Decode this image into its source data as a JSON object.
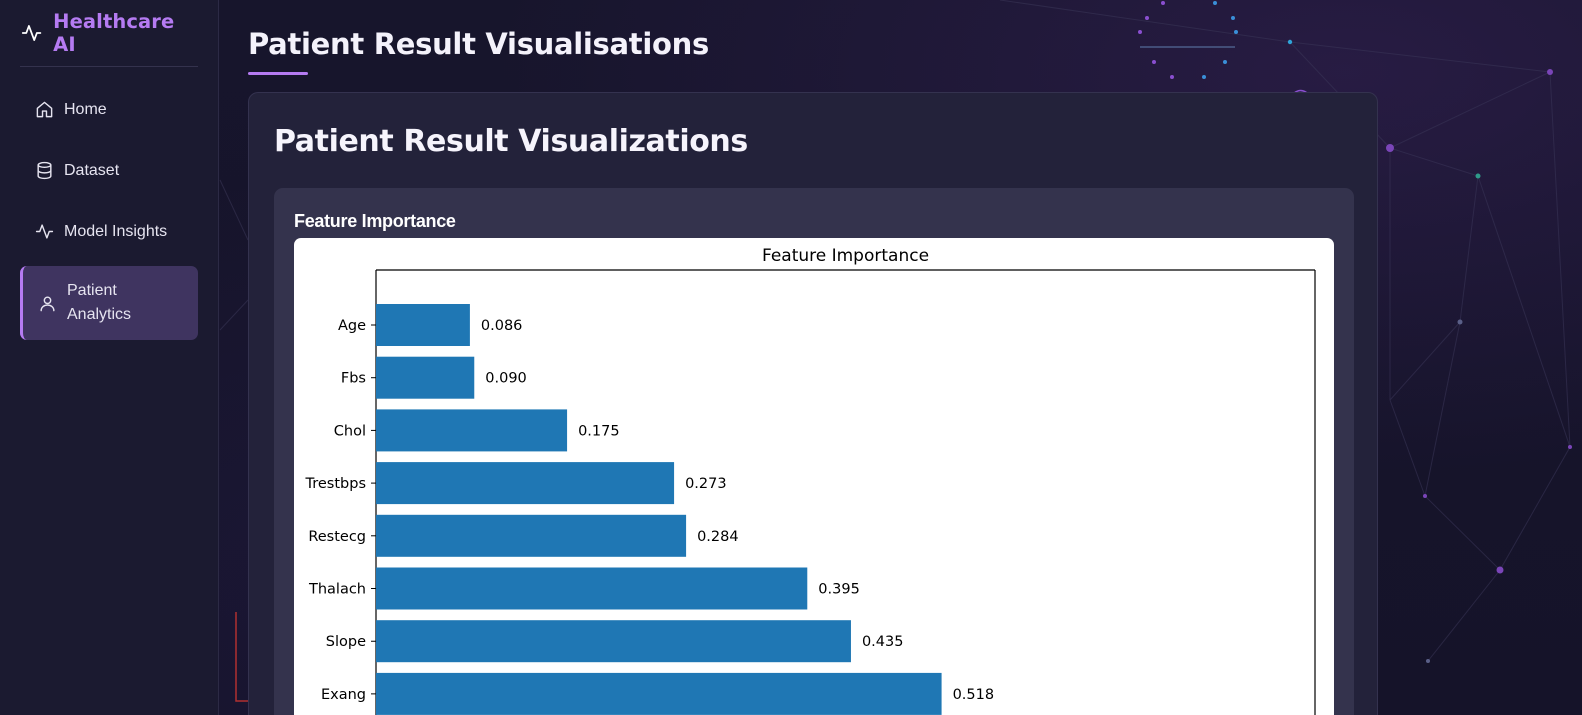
{
  "app": {
    "brand": "Healthcare AI",
    "accent": "#b57bf2"
  },
  "sidebar": {
    "items": [
      {
        "label": "Home",
        "icon": "home-icon",
        "active": false
      },
      {
        "label": "Dataset",
        "icon": "database-icon",
        "active": false
      },
      {
        "label": "Model Insights",
        "icon": "activity-icon",
        "active": false
      },
      {
        "label": "Patient Analytics",
        "icon": "user-icon",
        "active": true
      }
    ]
  },
  "page": {
    "title": "Patient Result Visualisations"
  },
  "card": {
    "title": "Patient Result Visualizations",
    "panel_title": "Feature Importance"
  },
  "chart_data": {
    "type": "bar",
    "orientation": "horizontal",
    "title": "Feature Importance",
    "categories": [
      "Age",
      "Fbs",
      "Chol",
      "Trestbps",
      "Restecg",
      "Thalach",
      "Slope",
      "Exang"
    ],
    "values": [
      0.086,
      0.09,
      0.175,
      0.273,
      0.284,
      0.395,
      0.435,
      0.518
    ],
    "value_labels": [
      "0.086",
      "0.090",
      "0.175",
      "0.273",
      "0.284",
      "0.395",
      "0.435",
      "0.518"
    ],
    "bar_color": "#1f77b4",
    "xlim": [
      0,
      0.86
    ],
    "grid": false
  }
}
